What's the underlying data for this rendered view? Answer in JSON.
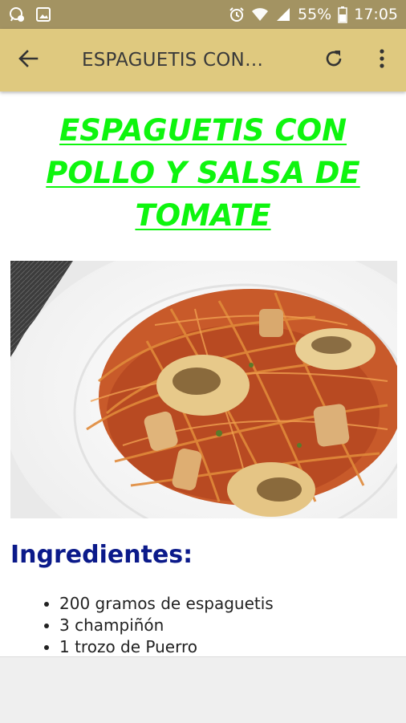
{
  "status_bar": {
    "battery": "55%",
    "time": "17:05",
    "icons": [
      "whatsapp-notification-icon",
      "gallery-notification-icon",
      "alarm-icon",
      "wifi-icon",
      "signal-icon",
      "battery-icon"
    ]
  },
  "app_bar": {
    "title": "ESPAGUETIS CON…",
    "icons": [
      "back-arrow-icon",
      "refresh-icon",
      "more-vert-icon"
    ]
  },
  "recipe": {
    "title": "ESPAGUETIS CON POLLO Y SALSA DE TOMATE",
    "ingredients_heading": "Ingredientes:",
    "ingredients": [
      "200 gramos de espaguetis",
      "3 champiñón",
      "1 trozo de Puerro"
    ]
  },
  "colors": {
    "status_bar": "#a39362",
    "app_bar": "#dfc97f",
    "title_green": "#0ef50e",
    "heading_blue": "#0b1a8a"
  }
}
